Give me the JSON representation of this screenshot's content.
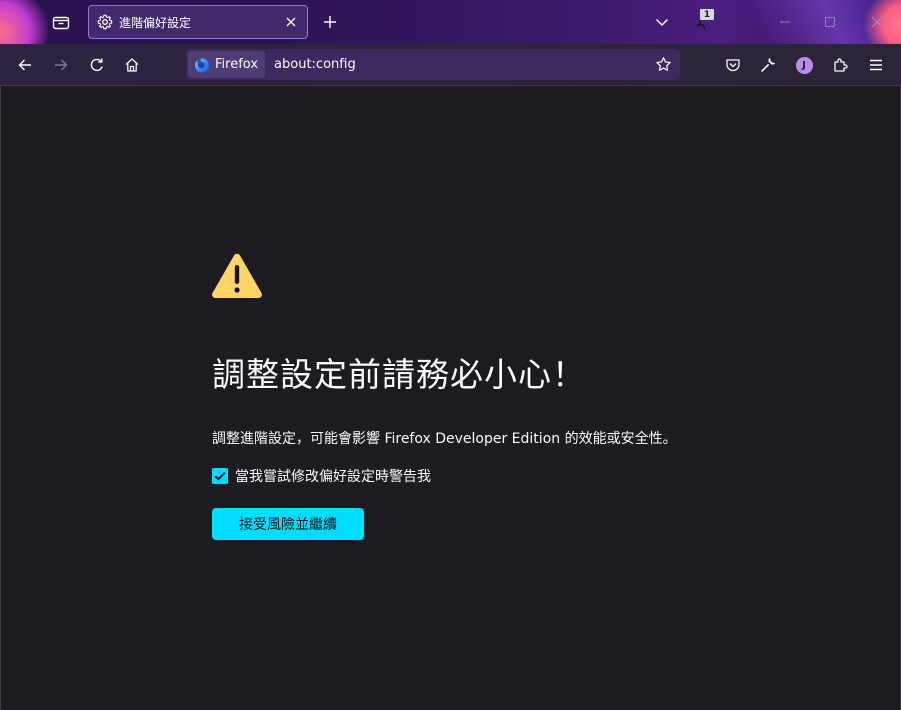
{
  "colors": {
    "accent": "#00ddff",
    "content_bg": "#1c1b22",
    "warning": "#ffd567",
    "tab_bg": "#42296d"
  },
  "tabbar": {
    "tabs_list_icon": "tab-list-icon",
    "active_tab": {
      "title": "進階偏好設定",
      "icon": "gear-icon"
    },
    "new_tab_icon": "plus-icon",
    "all_tabs_icon": "chevron-down-icon",
    "profile_badge": "1"
  },
  "navbar": {
    "identity_label": "Firefox",
    "url": "about:config"
  },
  "content": {
    "heading": "調整設定前請務必小心！",
    "description": "調整進階設定，可能會影響 Firefox Developer Edition 的效能或安全性。",
    "checkbox_label": "當我嘗試修改偏好設定時警告我",
    "checkbox_checked": true,
    "accept_button": "接受風險並繼續"
  },
  "account": {
    "initial": "J"
  }
}
